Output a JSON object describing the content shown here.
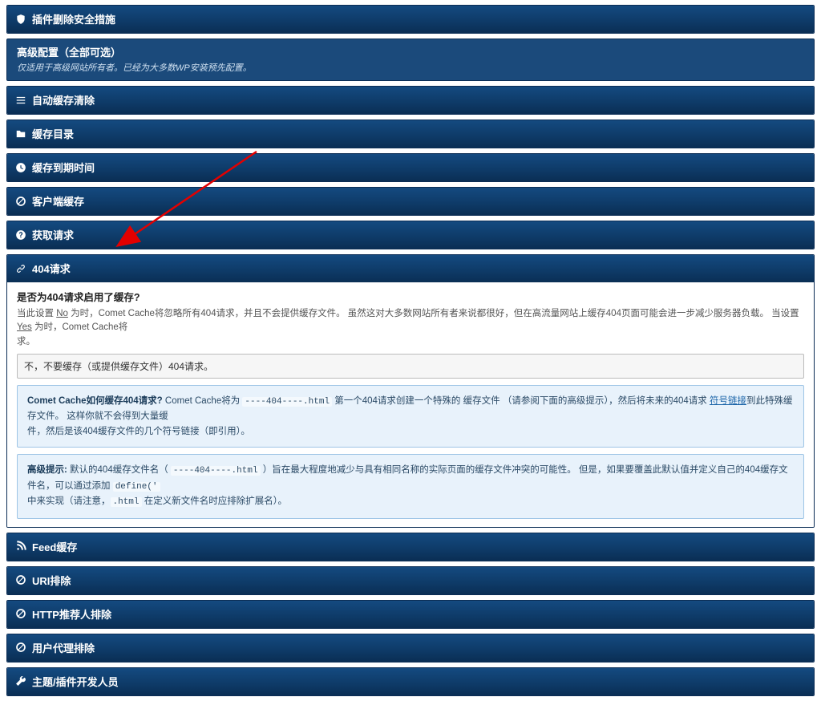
{
  "header0": {
    "title": "插件删除安全措施"
  },
  "advanced": {
    "title": "高级配置（全部可选）",
    "sub": "仅适用于高级网站所有者。已经为大多数WP安装预先配置。"
  },
  "sec_auto_clear": {
    "title": "自动缓存清除"
  },
  "sec_cache_dir": {
    "title": "缓存目录"
  },
  "sec_expire": {
    "title": "缓存到期时间"
  },
  "sec_client": {
    "title": "客户端缓存"
  },
  "sec_fetch": {
    "title": "获取请求"
  },
  "sec_404": {
    "title": "404请求",
    "question": "是否为404请求启用了缓存?",
    "desc_prefix": "当此设置 ",
    "desc_no": "No",
    "desc_mid1": " 为时，Comet Cache将忽略所有404请求，并且不会提供缓存文件。 虽然这对大多数网站所有者来说都很好，但在高流量网站上缓存404页面可能会进一步减少服务器负载。 当设置 ",
    "desc_yes": "Yes",
    "desc_mid2": " 为时，Comet Cache将",
    "desc_suffix": "求。",
    "select_text": "不，不要缓存（或提供缓存文件）404请求。",
    "info1_b": "Comet Cache如何缓存404请求?",
    "info1_text_a": " Comet Cache将为 ",
    "info1_code1": "----404----.html",
    "info1_text_b": " 第一个404请求创建一个特殊的 缓存文件 （请参阅下面的高级提示），然后将未来的404请求 ",
    "info1_link": "符号链接",
    "info1_text_c": "到此特殊缓存文件。 这样你就不会得到大量缓",
    "info1_line2": "件，然后是该404缓存文件的几个符号链接（即引用）。",
    "info2_b": "高级提示:",
    "info2_text_a": " 默认的404缓存文件名（ ",
    "info2_code1": "----404----.html",
    "info2_text_b": " ）旨在最大程度地减少与具有相同名称的实际页面的缓存文件冲突的可能性。 但是，如果要覆盖此默认值并定义自己的404缓存文件名，可以通过添加 ",
    "info2_code2": "define('",
    "info2_line2_a": "中来实现（请注意，",
    "info2_code3": ".html",
    "info2_line2_b": " 在定义新文件名时应排除扩展名）。"
  },
  "sec_feed": {
    "title": "Feed缓存"
  },
  "sec_uri": {
    "title": "URI排除"
  },
  "sec_ref": {
    "title": "HTTP推荐人排除"
  },
  "sec_ua": {
    "title": "用户代理排除"
  },
  "sec_dev": {
    "title": "主题/插件开发人员"
  }
}
